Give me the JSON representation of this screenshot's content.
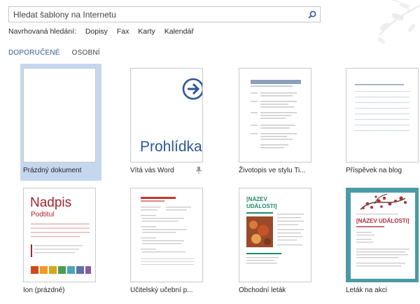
{
  "search": {
    "placeholder": "Hledat šablony na Internetu",
    "button_icon": "search-icon"
  },
  "suggested": {
    "label": "Navrhovaná hledání:",
    "links": [
      "Dopisy",
      "Fax",
      "Karty",
      "Kalendář"
    ]
  },
  "tabs": [
    {
      "label": "DOPORUČENÉ",
      "active": true
    },
    {
      "label": "OSOBNÍ",
      "active": false
    }
  ],
  "templates": [
    {
      "label": "Prázdný dokument",
      "selected": true
    },
    {
      "label": "Vítá vás Word",
      "thumb_text": "Prohlídka",
      "pinnable": true
    },
    {
      "label": "Životopis ve stylu Ti..."
    },
    {
      "label": "Příspěvek na blog"
    },
    {
      "label": "Ion (prázdné)",
      "thumb_title": "Nadpis",
      "thumb_subtitle": "Podtitul"
    },
    {
      "label": "Učitelský učební p..."
    },
    {
      "label": "Obchodní leták",
      "thumb_title": "[NÁZEV UDÁLOSTI]"
    },
    {
      "label": "Leták na akci",
      "thumb_title": "[NÁZEV UDÁLOSTI]"
    }
  ],
  "colors": {
    "accent": "#2b579a",
    "selected_bg": "#c5d7ef",
    "ion_red": "#a3232b",
    "business_green": "#1e8a6a",
    "event_teal": "#4a9aa6"
  },
  "ion_swatches": [
    "#d34817",
    "#f29b22",
    "#d4a71c",
    "#4e9b56",
    "#4aa5b8",
    "#5c6fb1",
    "#8a5aa7"
  ]
}
